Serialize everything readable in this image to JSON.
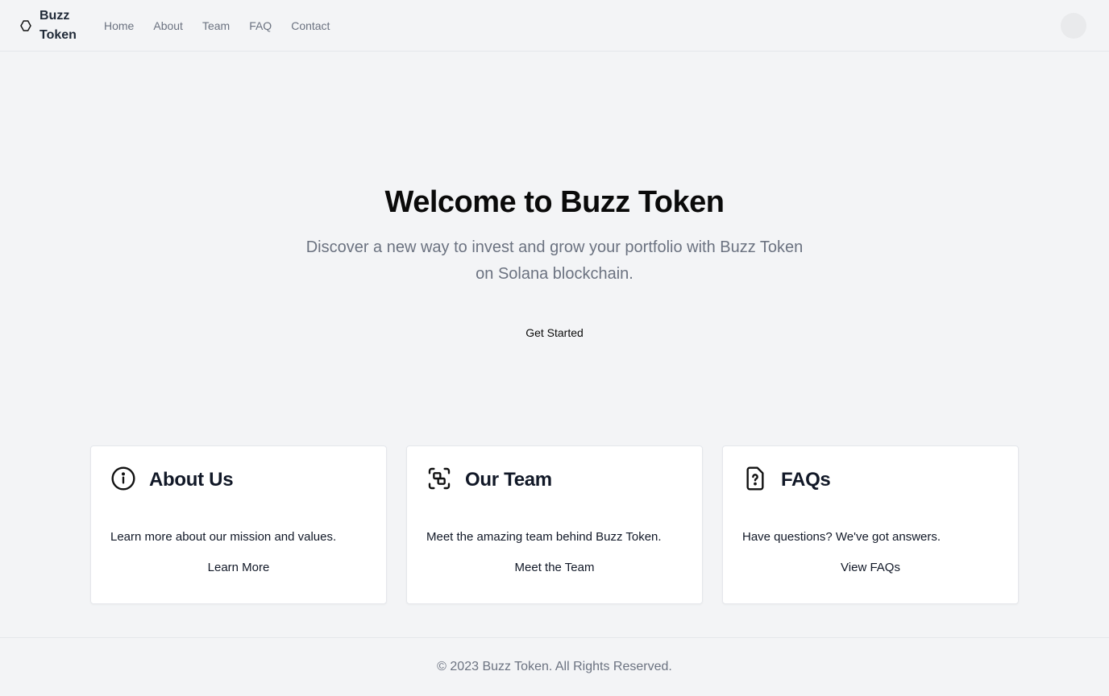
{
  "header": {
    "brand": "Buzz Token",
    "brand_icon": "hexagon-icon",
    "nav": [
      "Home",
      "About",
      "Team",
      "FAQ",
      "Contact"
    ]
  },
  "hero": {
    "title": "Welcome to Buzz Token",
    "subtitle": "Discover a new way to invest and grow your portfolio with Buzz Token on Solana blockchain.",
    "cta": "Get Started"
  },
  "cards": [
    {
      "icon": "info-icon",
      "title": "About Us",
      "description": "Learn more about our mission and values.",
      "link": "Learn More"
    },
    {
      "icon": "team-icon",
      "title": "Our Team",
      "description": "Meet the amazing team behind Buzz Token.",
      "link": "Meet the Team"
    },
    {
      "icon": "file-question-icon",
      "title": "FAQs",
      "description": "Have questions? We've got answers.",
      "link": "View FAQs"
    }
  ],
  "footer": {
    "text": "© 2023 Buzz Token. All Rights Reserved."
  }
}
